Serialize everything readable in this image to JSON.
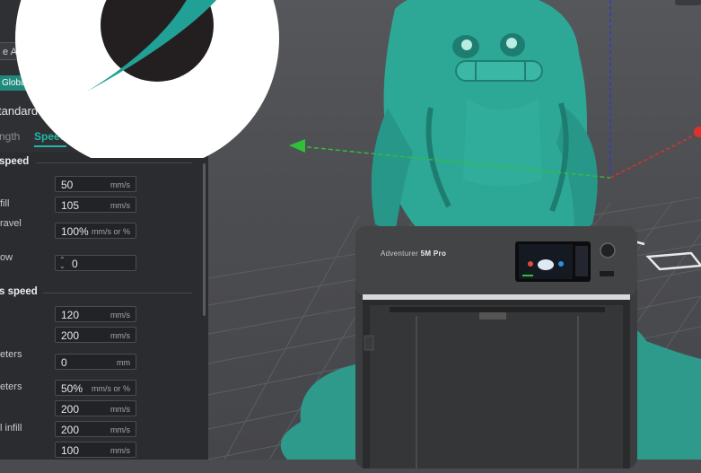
{
  "sidebar": {
    "preset_value": "e AB",
    "global_badge": "Global",
    "profile_name": "tandard @",
    "tabs": [
      {
        "label": "ngth",
        "active": false
      },
      {
        "label": "Speed",
        "active": true
      }
    ],
    "sections": [
      {
        "title": "speed",
        "rows": [
          {
            "label": "",
            "value": "50",
            "unit": "mm/s"
          },
          {
            "label": "fill",
            "value": "105",
            "unit": "mm/s"
          },
          {
            "label": "ravel",
            "value": "100%",
            "unit": "mm/s or %"
          },
          {
            "label": "ow",
            "value": "0",
            "unit": ""
          }
        ]
      },
      {
        "title": "s speed",
        "rows": [
          {
            "label": "",
            "value": "120",
            "unit": "mm/s"
          },
          {
            "label": "",
            "value": "200",
            "unit": "mm/s"
          },
          {
            "label": "eters",
            "value": "0",
            "unit": "mm"
          },
          {
            "label": "eters",
            "value": "50%",
            "unit": "mm/s or %"
          },
          {
            "label": "",
            "value": "200",
            "unit": "mm/s"
          },
          {
            "label": "l infill",
            "value": "200",
            "unit": "mm/s"
          },
          {
            "label": "",
            "value": "100",
            "unit": "mm/s"
          }
        ]
      }
    ]
  },
  "printer": {
    "name_prefix": "Adventurer",
    "name_suffix": "5M Pro"
  },
  "colors": {
    "accent": "#1fb9a6",
    "model": "#2ea896",
    "panel_bg": "#2b2c30",
    "x_axis": "#e0302b",
    "y_axis": "#2fbf3a",
    "z_axis": "#2b38d8"
  },
  "icons": [
    "brand-logo-icon",
    "spin-arrows-icon",
    "axis-arrow-icon",
    "touchscreen-icon",
    "power-knob-icon"
  ]
}
